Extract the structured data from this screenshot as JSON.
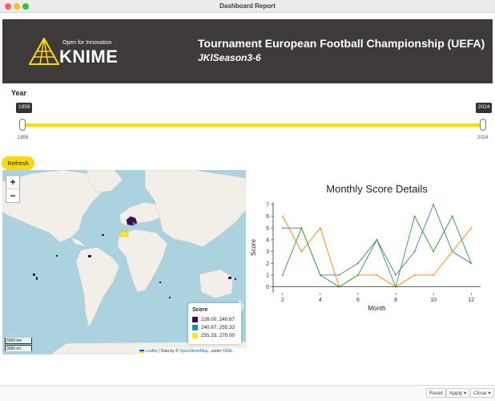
{
  "window": {
    "title": "Dashboard Report"
  },
  "banner": {
    "logo_tagline": "Open for Innovation",
    "logo_text": "KNIME",
    "title": "Tournament European Football Championship (UEFA)",
    "subtitle": "JKISeason3-6",
    "bg_color": "#3e3a39",
    "accent_color": "#ffd800"
  },
  "year_slider": {
    "label": "Year",
    "min": "1958",
    "max": "2024",
    "selected_start": "1958",
    "selected_end": "2024"
  },
  "refresh_label": "Refresh",
  "map": {
    "zoom_in": "+",
    "zoom_out": "−",
    "legend": {
      "title": "Score",
      "items": [
        {
          "label": "226.00, 240.67",
          "color": "#3b0f4f"
        },
        {
          "label": "240.67, 255.33",
          "color": "#21918c"
        },
        {
          "label": "255.33, 270.00",
          "color": "#fde725"
        }
      ]
    },
    "scale": {
      "km": "5000 km",
      "mi": "3000 mi"
    },
    "attribution": {
      "leaflet": "Leaflet",
      "data_prefix": "| Data by ©",
      "osm": "OpenStreetMap",
      "under": ", under",
      "odbl": "ODbL."
    }
  },
  "chart_data": {
    "type": "line",
    "title": "Monthly Score Details",
    "xlabel": "Month",
    "ylabel": "Score",
    "xlim": [
      1.5,
      12.5
    ],
    "ylim": [
      -0.5,
      7.2
    ],
    "x_ticks": [
      2,
      4,
      6,
      8,
      10,
      12
    ],
    "y_ticks": [
      0,
      1,
      2,
      3,
      4,
      5,
      6,
      7
    ],
    "x": [
      2,
      3,
      4,
      5,
      6,
      7,
      8,
      9,
      10,
      11,
      12
    ],
    "series": [
      {
        "color": "#4c72b0",
        "values": [
          5,
          5,
          1,
          1,
          2,
          4,
          1,
          3,
          7,
          3,
          2
        ]
      },
      {
        "color": "#ff7f0e",
        "values": [
          6,
          3,
          5,
          0,
          1,
          1,
          0,
          1,
          1,
          3,
          5
        ]
      },
      {
        "color": "#2ca02c",
        "values": [
          1,
          5,
          1,
          0,
          1,
          4,
          0,
          6,
          3,
          6,
          2
        ]
      }
    ]
  },
  "footer": {
    "reset": "Reset",
    "apply": "Apply ▾",
    "close": "Close ▾"
  }
}
